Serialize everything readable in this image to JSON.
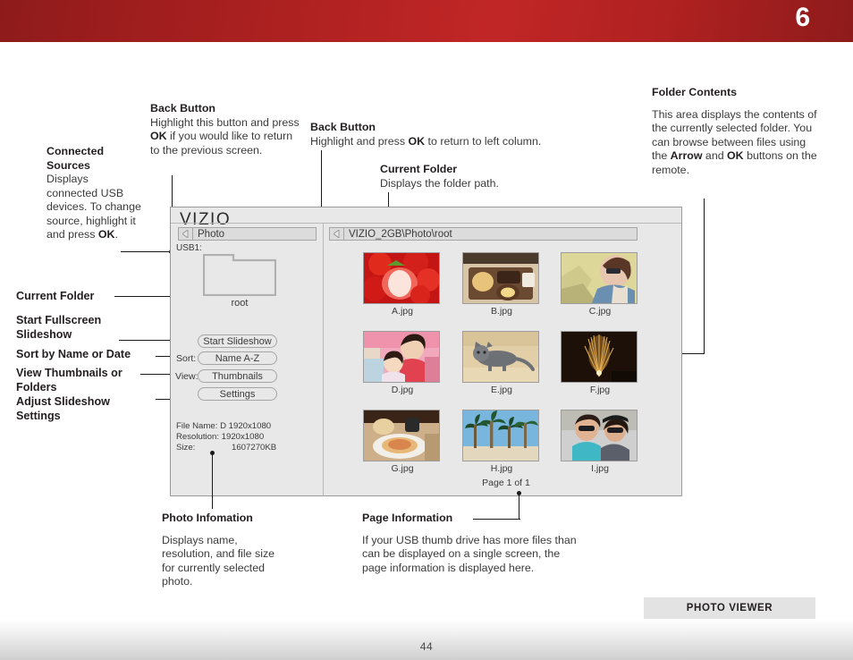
{
  "header": {
    "chapter_number": "6"
  },
  "footer": {
    "page_number": "44",
    "section_tag": "PHOTO VIEWER"
  },
  "callouts": {
    "connected_sources": {
      "title_line1": "Connected",
      "title_line2": "Sources",
      "body": "Displays connected USB devices. To change source, highlight it and press ",
      "body_bold": "OK",
      "body_end": "."
    },
    "back_button_left": {
      "title": "Back Button",
      "body_1": "Highlight this button and press ",
      "body_bold": "OK",
      "body_2": " if you would like to return to the previous screen."
    },
    "back_button_right": {
      "title": "Back Button",
      "body_1": "Highlight and press ",
      "body_bold": "OK",
      "body_2": " to return to left column."
    },
    "current_folder_top": {
      "title": "Current Folder",
      "body": "Displays the folder path."
    },
    "folder_contents": {
      "title": "Folder Contents",
      "body_1": "This area displays the contents of the currently selected folder. You can browse between files using the ",
      "body_bold_1": "Arrow",
      "body_2": " and ",
      "body_bold_2": "OK",
      "body_3": " buttons on the remote."
    },
    "photo_information": {
      "title": "Photo Infomation",
      "body": "Displays name, resolution, and file size for currently selected photo."
    },
    "page_information": {
      "title": "Page Information",
      "body": "If your USB thumb drive has more files than can be displayed on a single screen, the page information is displayed here."
    }
  },
  "left_labels": {
    "current_folder": "Current Folder",
    "start_fullscreen_slideshow": "Start Fullscreen\nSlideshow",
    "sort_by_name_or_date": "Sort by Name or Date",
    "view_thumbnails_or_folders": "View Thumbnails or\nFolders",
    "adjust_slideshow_settings": "Adjust Slideshow\nSettings"
  },
  "tv_ui": {
    "brand": "VIZIO",
    "back_bar_label": "Photo",
    "path_bar_label": "VIZIO_2GB\\Photo\\root",
    "usb_label": "USB1:",
    "folder_name": "root",
    "buttons": {
      "start_slideshow": "Start Slideshow",
      "sort_value": "Name A-Z",
      "view_value": "Thumbnails",
      "settings": "Settings"
    },
    "sub_labels": {
      "sort": "Sort:",
      "view": "View:"
    },
    "file_info": {
      "file_name_label": "File Name:",
      "file_name_value": "D 1920x1080",
      "resolution_label": "Resolution:",
      "resolution_value": "1920x1080",
      "size_label": "Size:",
      "size_value": "1607270KB"
    },
    "page_label": "Page 1 of 1",
    "thumbnails": [
      {
        "name": "A.jpg",
        "subject": "strawberries"
      },
      {
        "name": "B.jpg",
        "subject": "food-tray"
      },
      {
        "name": "C.jpg",
        "subject": "woman-sunglasses"
      },
      {
        "name": "D.jpg",
        "subject": "two-girls"
      },
      {
        "name": "E.jpg",
        "subject": "grey-cat"
      },
      {
        "name": "F.jpg",
        "subject": "fireworks"
      },
      {
        "name": "G.jpg",
        "subject": "plated-meal"
      },
      {
        "name": "H.jpg",
        "subject": "palm-trees"
      },
      {
        "name": "I.jpg",
        "subject": "couple-selfie"
      }
    ]
  },
  "colors": {
    "band_red": "#b62323",
    "panel_grey": "#e8e8e8",
    "border_grey": "#9a9a9a"
  }
}
